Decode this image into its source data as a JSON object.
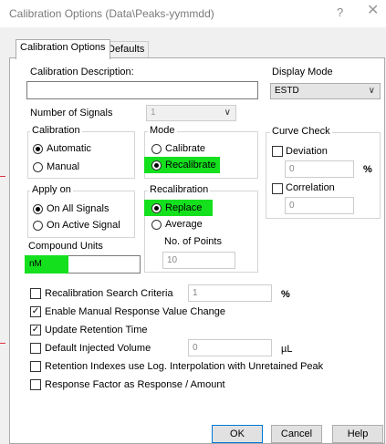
{
  "window": {
    "title": "Calibration Options (Data\\Peaks-yymmdd)",
    "help_glyph": "?",
    "close_glyph": "✕"
  },
  "tabs": [
    {
      "label": "Calibration Options",
      "active": true
    },
    {
      "label": "Defaults",
      "active": false
    }
  ],
  "calibration_description": {
    "label": "Calibration Description:",
    "value": ""
  },
  "display_mode": {
    "label": "Display Mode",
    "value": "ESTD"
  },
  "number_of_signals": {
    "label": "Number of Signals",
    "value": "1"
  },
  "calibration": {
    "legend": "Calibration",
    "options": [
      {
        "label": "Automatic",
        "selected": true
      },
      {
        "label": "Manual",
        "selected": false
      }
    ]
  },
  "mode": {
    "legend": "Mode",
    "options": [
      {
        "label": "Calibrate",
        "selected": false
      },
      {
        "label": "Recalibrate",
        "selected": true
      }
    ]
  },
  "curve_check": {
    "legend": "Curve Check",
    "deviation_label": "Deviation",
    "deviation_value": "0",
    "deviation_unit": "%",
    "correlation_label": "Correlation",
    "correlation_value": "0"
  },
  "apply_on": {
    "legend": "Apply on",
    "options": [
      {
        "label": "On All Signals",
        "selected": true
      },
      {
        "label": "On Active Signal",
        "selected": false
      }
    ]
  },
  "recalibration": {
    "legend": "Recalibration",
    "options": [
      {
        "label": "Replace",
        "selected": true
      },
      {
        "label": "Average",
        "selected": false
      }
    ],
    "points_label": "No. of Points",
    "points_value": "10"
  },
  "compound_units": {
    "label": "Compound Units",
    "value": "nM"
  },
  "recal_search": {
    "label": "Recalibration Search Criteria",
    "checked": false,
    "value": "1",
    "unit": "%"
  },
  "options": {
    "manual_response": {
      "label": "Enable Manual Response Value Change",
      "checked": true
    },
    "update_rt": {
      "label": "Update Retention Time",
      "checked": true
    },
    "default_volume": {
      "label": "Default Injected Volume",
      "checked": false,
      "value": "0",
      "unit": "µL"
    },
    "ri_log": {
      "label": "Retention Indexes use Log. Interpolation with Unretained Peak",
      "checked": false
    },
    "rf_response": {
      "label": "Response Factor as Response / Amount",
      "checked": false
    }
  },
  "buttons": {
    "ok": "OK",
    "cancel": "Cancel",
    "help": "Help"
  },
  "colors": {
    "highlight": "#14e01e",
    "accent_border": "#0078d7"
  }
}
